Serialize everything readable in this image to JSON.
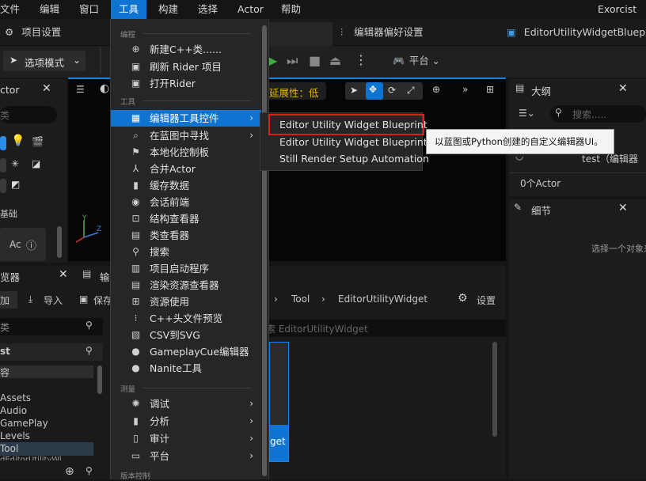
{
  "menubar": {
    "items": [
      "文件",
      "编辑",
      "窗口",
      "工具",
      "构建",
      "选择",
      "Actor",
      "帮助"
    ],
    "project": "Exorcist"
  },
  "tabs": {
    "project_settings": "项目设置",
    "editor_prefs": "编辑器偏好设置",
    "widget_tab": "EditorUtilityWidgetBluep..."
  },
  "toolbar": {
    "select_mode": "选项模式",
    "platform": "平台"
  },
  "left_panel": {
    "title": "ctor",
    "search_placeholder": "类",
    "basic": "基础",
    "ac_label": "Ac"
  },
  "viewport": {
    "scalability": "延展性：低"
  },
  "outliner": {
    "title": "大纲",
    "search_placeholder": "搜索.....",
    "row": "test（编辑器",
    "count": "0个Actor"
  },
  "details": {
    "title": "细节",
    "empty": "选择一个对象来"
  },
  "content_browser": {
    "title": "览器",
    "tab2": "输",
    "add": "加",
    "import": "导入",
    "save": "保存",
    "filter_label": "类",
    "tree_root": "st",
    "tree_items": [
      "容",
      "Assets",
      "Audio",
      "GamePlay",
      "Levels",
      "Tool",
      "dEditorUtilityWi"
    ],
    "breadcrumb": [
      "Tool",
      "EditorUtilityWidget"
    ],
    "settings": "设置",
    "search_placeholder": "索 EditorUtilityWidget",
    "asset_label": "get"
  },
  "tools_menu": {
    "sections": {
      "programming": "编程",
      "tools": "工具",
      "instrumentation": "测量",
      "source_control": "版本控制"
    },
    "programming_items": [
      {
        "label": "新建C++类......",
        "icon": "plus-icon"
      },
      {
        "label": "刷新 Rider 项目",
        "icon": "refresh-icon"
      },
      {
        "label": "打开Rider",
        "icon": "code-icon"
      }
    ],
    "tools_items": [
      {
        "label": "编辑器工具控件",
        "icon": "widget-icon",
        "submenu": true
      },
      {
        "label": "在蓝图中寻找",
        "icon": "find-icon",
        "submenu": true
      },
      {
        "label": "本地化控制板",
        "icon": "flag-icon"
      },
      {
        "label": "合并Actor",
        "icon": "merge-icon"
      },
      {
        "label": "缓存数据",
        "icon": "chart-icon"
      },
      {
        "label": "会话前端",
        "icon": "session-icon"
      },
      {
        "label": "结构查看器",
        "icon": "struct-icon"
      },
      {
        "label": "类查看器",
        "icon": "class-icon"
      },
      {
        "label": "搜索",
        "icon": "search-icon"
      },
      {
        "label": "项目启动程序",
        "icon": "launcher-icon"
      },
      {
        "label": "渲染资源查看器",
        "icon": "render-icon"
      },
      {
        "label": "资源使用",
        "icon": "grid-icon"
      },
      {
        "label": "C++头文件预览",
        "icon": "header-icon"
      },
      {
        "label": "CSV到SVG",
        "icon": "csv-icon"
      },
      {
        "label": "GameplayCue编辑器",
        "icon": "cue-icon"
      },
      {
        "label": "Nanite工具",
        "icon": "nanite-icon"
      }
    ],
    "instrumentation_items": [
      {
        "label": "调试",
        "icon": "debug-icon",
        "submenu": true
      },
      {
        "label": "分析",
        "icon": "analyze-icon",
        "submenu": true
      },
      {
        "label": "审计",
        "icon": "audit-icon",
        "submenu": true
      },
      {
        "label": "平台",
        "icon": "platform-icon",
        "submenu": true
      }
    ]
  },
  "submenu": {
    "items": [
      "Editor Utility Widget Blueprint",
      "Editor Utility Widget Blueprint",
      "Still Render Setup Automation"
    ]
  },
  "tooltip": {
    "text": "以蓝图或Python创建的自定义编辑器UI。"
  },
  "colors": {
    "accent": "#0f74d1",
    "highlight_border": "#e21b1b",
    "play_green": "#3fae3f"
  }
}
